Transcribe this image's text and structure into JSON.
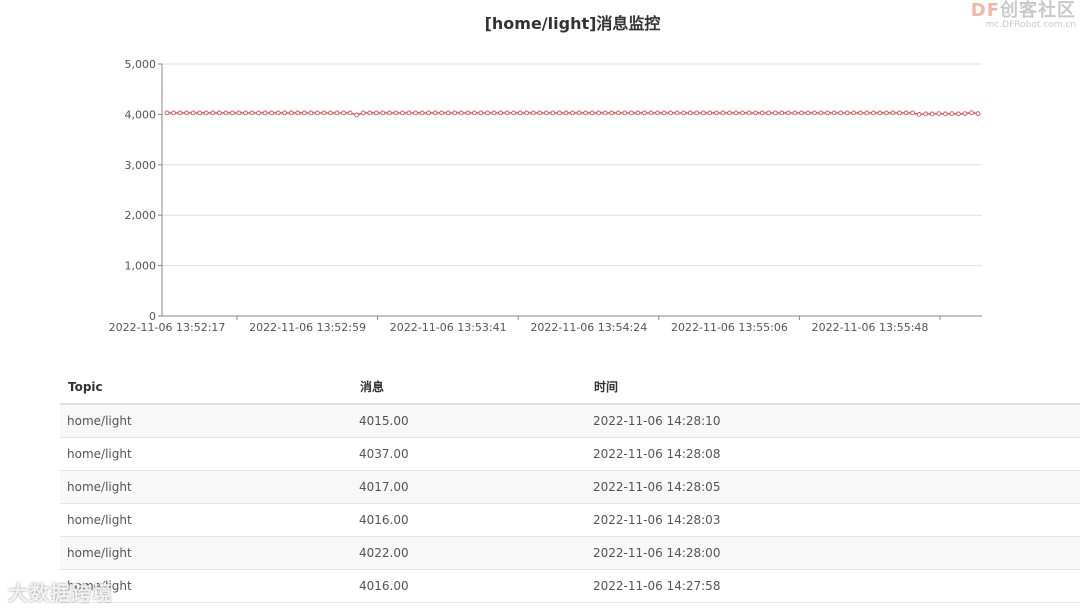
{
  "chart_data": {
    "type": "line",
    "title": "[home/light]消息监控",
    "xlabel": "",
    "ylabel": "",
    "ylim": [
      0,
      5000
    ],
    "yticks": [
      0,
      1000,
      2000,
      3000,
      4000,
      5000
    ],
    "ytick_labels": [
      "0",
      "1,000",
      "2,000",
      "3,000",
      "4,000",
      "5,000"
    ],
    "xtick_labels": [
      "2022-11-06 13:52:17",
      "2022-11-06 13:52:59",
      "2022-11-06 13:53:41",
      "2022-11-06 13:54:24",
      "2022-11-06 13:55:06",
      "2022-11-06 13:55:48"
    ],
    "grid": true,
    "line_color": "#d9534f",
    "series": [
      {
        "values": [
          4030,
          4030,
          4030,
          4030,
          4030,
          4030,
          4030,
          4030,
          4030,
          4030,
          4030,
          4030,
          4030,
          4030,
          4030,
          4030,
          4030,
          4030,
          4030,
          4030,
          4030,
          4030,
          4030,
          4030,
          4030,
          4030,
          4030,
          4030,
          4030,
          3990,
          4030,
          4030,
          4030,
          4030,
          4030,
          4030,
          4030,
          4030,
          4030,
          4030,
          4030,
          4030,
          4030,
          4030,
          4030,
          4030,
          4030,
          4030,
          4030,
          4030,
          4030,
          4030,
          4030,
          4030,
          4030,
          4030,
          4030,
          4030,
          4030,
          4030,
          4030,
          4030,
          4030,
          4030,
          4030,
          4030,
          4030,
          4030,
          4030,
          4030,
          4030,
          4030,
          4030,
          4030,
          4030,
          4030,
          4030,
          4030,
          4030,
          4030,
          4030,
          4030,
          4030,
          4030,
          4030,
          4030,
          4030,
          4030,
          4030,
          4030,
          4030,
          4030,
          4030,
          4030,
          4030,
          4030,
          4030,
          4030,
          4030,
          4030,
          4030,
          4030,
          4030,
          4030,
          4030,
          4030,
          4030,
          4030,
          4030,
          4030,
          4030,
          4030,
          4030,
          4030,
          4030,
          4000,
          4010,
          4010,
          4015,
          4010,
          4015,
          4010,
          4015,
          4035,
          4015
        ]
      }
    ]
  },
  "table": {
    "headers": {
      "topic": "Topic",
      "message": "消息",
      "time": "时间"
    },
    "rows": [
      {
        "topic": "home/light",
        "message": "4015.00",
        "time": "2022-11-06 14:28:10"
      },
      {
        "topic": "home/light",
        "message": "4037.00",
        "time": "2022-11-06 14:28:08"
      },
      {
        "topic": "home/light",
        "message": "4017.00",
        "time": "2022-11-06 14:28:05"
      },
      {
        "topic": "home/light",
        "message": "4016.00",
        "time": "2022-11-06 14:28:03"
      },
      {
        "topic": "home/light",
        "message": "4022.00",
        "time": "2022-11-06 14:28:00"
      },
      {
        "topic": "home/light",
        "message": "4016.00",
        "time": "2022-11-06 14:27:58"
      }
    ]
  },
  "watermark_top": {
    "main_prefix": "DF",
    "main": "创客社区",
    "sub": "mc.DFRobot.com.cn"
  },
  "watermark_bottom": {
    "text": "大数据跨境"
  }
}
